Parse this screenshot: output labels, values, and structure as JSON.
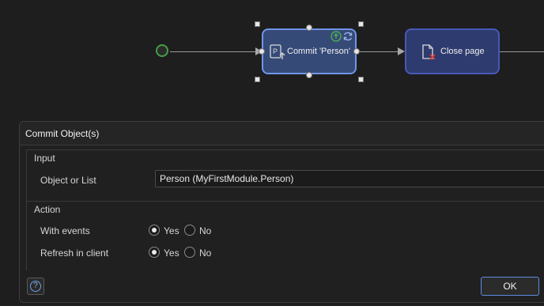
{
  "flow": {
    "commit_activity": {
      "label": "Commit 'Person'",
      "icon": "commit-object-icon"
    },
    "close_activity": {
      "label": "Close page",
      "icon": "close-page-icon"
    },
    "colors": {
      "start_event": "#43a047",
      "selected_border": "#6f95e8",
      "activity_fill": "#2e3b6e"
    }
  },
  "dialog": {
    "title": "Commit Object(s)",
    "input_group": {
      "title": "Input",
      "object_label": "Object or List",
      "object_value": "Person (MyFirstModule.Person)"
    },
    "action_group": {
      "title": "Action",
      "with_events_label": "With events",
      "refresh_label": "Refresh in client",
      "yes_label": "Yes",
      "no_label": "No",
      "with_events_value": "Yes",
      "refresh_value": "Yes"
    },
    "help_icon": "help-question-icon",
    "ok_label": "OK"
  }
}
